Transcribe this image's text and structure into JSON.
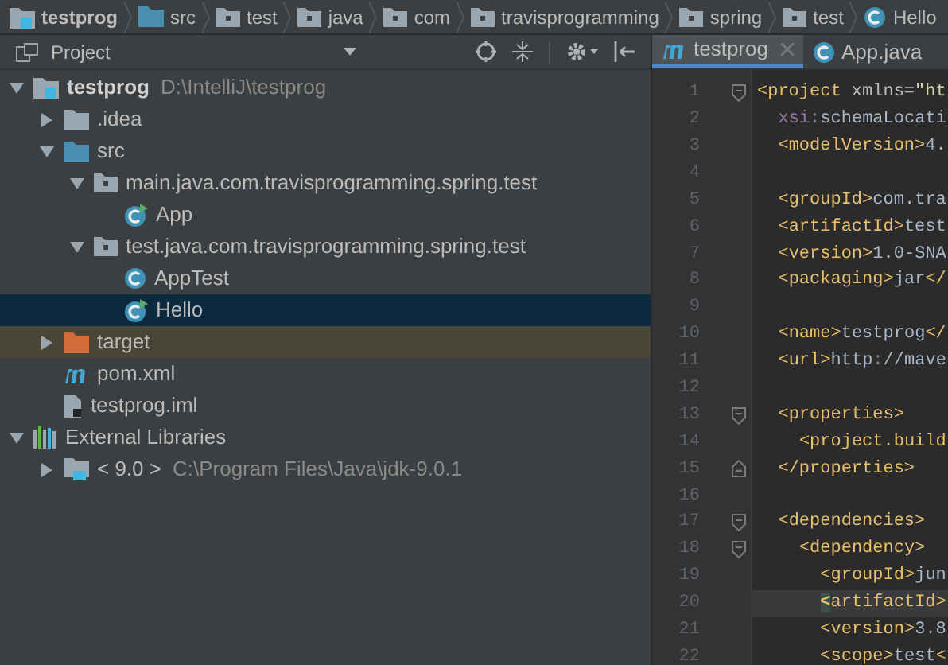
{
  "breadcrumbs": [
    {
      "label": "testprog",
      "kind": "module"
    },
    {
      "label": "src",
      "kind": "source"
    },
    {
      "label": "test",
      "kind": "package"
    },
    {
      "label": "java",
      "kind": "package"
    },
    {
      "label": "com",
      "kind": "package"
    },
    {
      "label": "travisprogramming",
      "kind": "package"
    },
    {
      "label": "spring",
      "kind": "package"
    },
    {
      "label": "test",
      "kind": "package"
    },
    {
      "label": "Hello",
      "kind": "class"
    }
  ],
  "project_panel": {
    "title": "Project",
    "tree": [
      {
        "label": "testprog",
        "path": "D:\\IntelliJ\\testprog",
        "kind": "module",
        "expanded": true,
        "selected": false,
        "children": [
          {
            "label": ".idea",
            "kind": "folder",
            "expanded": false,
            "selected": false
          },
          {
            "label": "src",
            "kind": "source",
            "expanded": true,
            "selected": false,
            "children": [
              {
                "label": "main.java.com.travisprogramming.spring.test",
                "kind": "package",
                "expanded": true,
                "selected": false,
                "children": [
                  {
                    "label": "App",
                    "kind": "runclass",
                    "selected": false
                  }
                ]
              },
              {
                "label": "test.java.com.travisprogramming.spring.test",
                "kind": "package",
                "expanded": true,
                "selected": false,
                "children": [
                  {
                    "label": "AppTest",
                    "kind": "class",
                    "selected": false
                  },
                  {
                    "label": "Hello",
                    "kind": "runclass",
                    "selected": true
                  }
                ]
              }
            ]
          },
          {
            "label": "target",
            "kind": "excluded",
            "expanded": false,
            "selected": false
          },
          {
            "label": "pom.xml",
            "kind": "maven",
            "selected": false
          },
          {
            "label": "testprog.iml",
            "kind": "iml",
            "selected": false
          }
        ]
      },
      {
        "label": "External Libraries",
        "kind": "libraries",
        "expanded": true,
        "selected": false,
        "children": [
          {
            "label": "< 9.0 >",
            "path": "C:\\Program Files\\Java\\jdk-9.0.1",
            "kind": "jdk",
            "expanded": false,
            "selected": false
          }
        ]
      }
    ]
  },
  "editor": {
    "tabs": [
      {
        "label": "testprog",
        "kind": "maven",
        "selected": true,
        "closable": true
      },
      {
        "label": "App.java",
        "kind": "class",
        "selected": false,
        "closable": false
      }
    ],
    "lines": [
      {
        "number": "1",
        "fold_start": true,
        "current": false,
        "text": "<project xmlns=\"ht"
      },
      {
        "number": "2",
        "current": false,
        "text": "  xsi:schemaLocati"
      },
      {
        "number": "3",
        "current": false,
        "text": "  <modelVersion>4."
      },
      {
        "number": "4",
        "current": false
      },
      {
        "number": "5",
        "current": false,
        "text": "  <groupId>com.tra"
      },
      {
        "number": "6",
        "current": false,
        "text": "  <artifactId>test"
      },
      {
        "number": "7",
        "current": false,
        "text": "  <version>1.0-SNA"
      },
      {
        "number": "8",
        "current": false,
        "text": "  <packaging>jar</"
      },
      {
        "number": "9",
        "current": false
      },
      {
        "number": "10",
        "current": false,
        "text": "  <name>testprog</"
      },
      {
        "number": "11",
        "current": false,
        "text": "  <url>http://mave"
      },
      {
        "number": "12",
        "current": false
      },
      {
        "number": "13",
        "fold_start": true,
        "current": false,
        "text": "  <properties>"
      },
      {
        "number": "14",
        "current": false,
        "text": "    <project.build"
      },
      {
        "number": "15",
        "fold_end": true,
        "current": false,
        "text": "  </properties>"
      },
      {
        "number": "16",
        "current": false
      },
      {
        "number": "17",
        "fold_start": true,
        "current": false,
        "text": "  <dependencies>"
      },
      {
        "number": "18",
        "fold_start": true,
        "current": false,
        "text": "    <dependency>"
      },
      {
        "number": "19",
        "current": false,
        "text": "      <groupId>jun"
      },
      {
        "number": "20",
        "current": true,
        "text": "      <artifactId>"
      },
      {
        "number": "21",
        "current": false,
        "text": "      <version>3.8"
      },
      {
        "number": "22",
        "current": false,
        "text": "      <scope>test<"
      }
    ]
  }
}
